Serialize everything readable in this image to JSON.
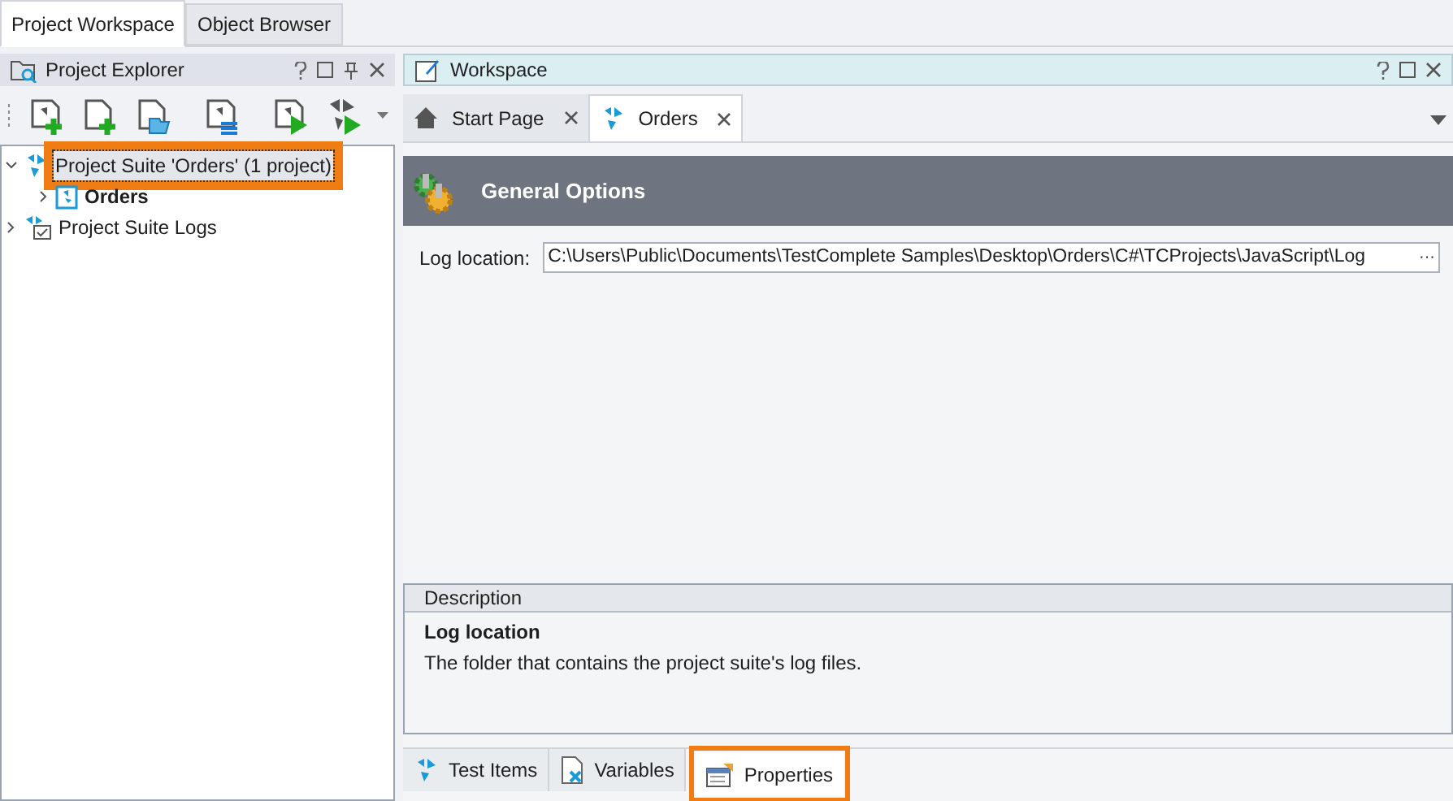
{
  "top_tabs": [
    {
      "label": "Project Workspace",
      "selected": true
    },
    {
      "label": "Object Browser",
      "selected": false
    }
  ],
  "explorer": {
    "title": "Project Explorer",
    "tree": [
      {
        "label": "Project Suite 'Orders' (1 project)",
        "kind": "suite",
        "expanded": true,
        "selected": true,
        "highlighted": true,
        "bold": false,
        "children": [
          {
            "label": "Orders",
            "kind": "project",
            "expanded": false,
            "selected": false,
            "highlighted": false,
            "bold": true
          }
        ]
      },
      {
        "label": "Project Suite Logs",
        "kind": "logs",
        "expanded": false,
        "selected": false,
        "highlighted": false,
        "bold": false
      }
    ]
  },
  "workspace": {
    "title": "Workspace",
    "tabs": [
      {
        "label": "Start Page",
        "kind": "home",
        "selected": false
      },
      {
        "label": "Orders",
        "kind": "suite",
        "selected": true
      }
    ],
    "banner": "General Options",
    "field": {
      "label": "Log location:",
      "value": "C:\\Users\\Public\\Documents\\TestComplete Samples\\Desktop\\Orders\\C#\\TCProjects\\JavaScript\\Log",
      "button": "···"
    },
    "description": {
      "header": "Description",
      "title": "Log location",
      "text": "The folder that contains the project suite's log files."
    },
    "bottom_tabs": [
      {
        "label": "Test Items",
        "kind": "suite",
        "selected": false,
        "highlighted": false
      },
      {
        "label": "Variables",
        "kind": "variables",
        "selected": false,
        "highlighted": false
      },
      {
        "label": "Properties",
        "kind": "properties",
        "selected": true,
        "highlighted": true
      }
    ]
  }
}
